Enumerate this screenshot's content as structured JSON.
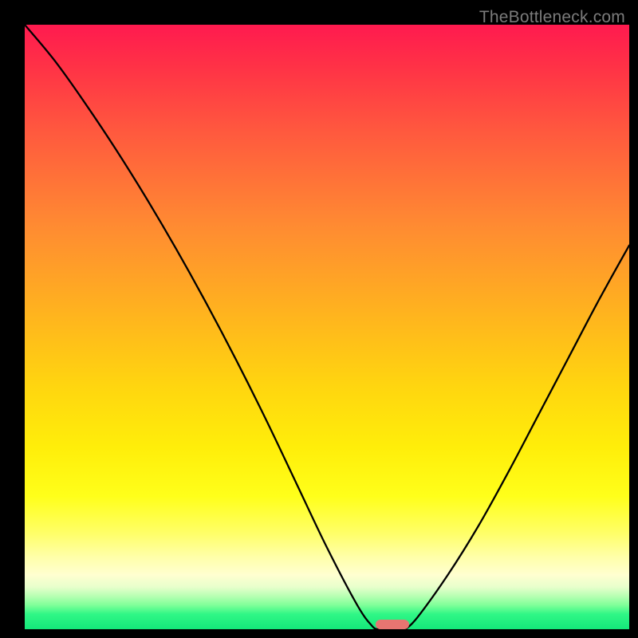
{
  "watermark": "TheBottleneck.com",
  "colors": {
    "frame": "#000000",
    "curve": "#000000",
    "marker": "#e77571"
  },
  "chart_data": {
    "type": "line",
    "title": "",
    "xlabel": "",
    "ylabel": "",
    "xlim": [
      0,
      100
    ],
    "ylim": [
      0,
      100
    ],
    "grid": false,
    "series": [
      {
        "name": "bottleneck-left",
        "x": [
          0,
          5,
          10,
          15,
          20,
          25,
          30,
          35,
          40,
          45,
          50,
          55,
          57.5,
          58.5
        ],
        "values": [
          100,
          94,
          87,
          79.5,
          71.5,
          63,
          54,
          44.5,
          34.5,
          24,
          13.5,
          4,
          0.5,
          0
        ]
      },
      {
        "name": "bottleneck-right",
        "x": [
          63,
          65,
          70,
          75,
          80,
          85,
          90,
          95,
          100
        ],
        "values": [
          0,
          2,
          9,
          17,
          26,
          35.5,
          45,
          54.5,
          63.5
        ]
      }
    ],
    "marker": {
      "x_center": 60.8,
      "y": 0,
      "width_pct": 5.5,
      "height_pct": 1.6,
      "note": "pill-shaped bottleneck indicator centered near x≈60.8%"
    },
    "gradient_stops": [
      {
        "pos": 0,
        "color": "#ff1a4f"
      },
      {
        "pos": 0.33,
        "color": "#ff8a32"
      },
      {
        "pos": 0.6,
        "color": "#ffd60f"
      },
      {
        "pos": 0.84,
        "color": "#ffff66"
      },
      {
        "pos": 0.96,
        "color": "#80ff99"
      },
      {
        "pos": 1.0,
        "color": "#14e87a"
      }
    ]
  }
}
